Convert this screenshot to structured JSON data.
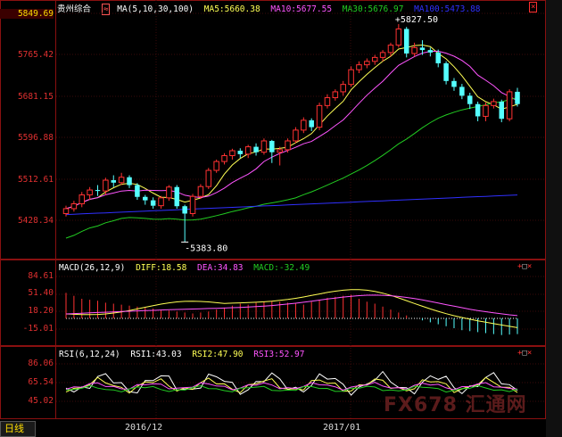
{
  "main": {
    "title": "贵州综合",
    "ma_label": "MA(5,10,30,100)",
    "ma5": "MA5:5660.38",
    "ma10": "MA10:5677.55",
    "ma30": "MA30:5676.97",
    "ma100": "MA100:5473.88",
    "y_labels": [
      "5849.69",
      "5765.42",
      "5681.15",
      "5596.88",
      "5512.61",
      "5428.34"
    ],
    "high_note": "5827.50",
    "low_note": "5383.80",
    "colors": {
      "up": "#ff3232",
      "down": "#55ffff",
      "ma5": "#ffff55",
      "ma10": "#ff55ff",
      "ma30": "#22cc22",
      "ma100": "#3030ff"
    }
  },
  "macd": {
    "label": "MACD(26,12,9)",
    "diff": "DIFF:18.58",
    "dea": "DEA:34.83",
    "macd": "MACD:-32.49",
    "y_labels": [
      "84.61",
      "51.40",
      "18.20",
      "-15.01"
    ]
  },
  "rsi": {
    "label": "RSI(6,12,24)",
    "rsi1": "RSI1:43.03",
    "rsi2": "RSI2:47.90",
    "rsi3": "RSI3:52.97",
    "y_labels": [
      "86.06",
      "65.54",
      "45.02"
    ]
  },
  "x_dates": [
    "2016/12",
    "2017/01"
  ],
  "period_button": "日线",
  "watermark": "FX678 汇通网",
  "candles": [
    [
      5442,
      5452,
      5436,
      5458
    ],
    [
      5452,
      5462,
      5446,
      5468
    ],
    [
      5462,
      5480,
      5455,
      5486
    ],
    [
      5480,
      5490,
      5470,
      5496
    ],
    [
      5490,
      5488,
      5478,
      5500
    ],
    [
      5488,
      5510,
      5480,
      5515
    ],
    [
      5510,
      5505,
      5496,
      5520
    ],
    [
      5505,
      5516,
      5500,
      5525
    ],
    [
      5516,
      5500,
      5494,
      5520
    ],
    [
      5500,
      5476,
      5470,
      5504
    ],
    [
      5476,
      5469,
      5460,
      5480
    ],
    [
      5469,
      5458,
      5452,
      5475
    ],
    [
      5458,
      5474,
      5452,
      5478
    ],
    [
      5474,
      5496,
      5468,
      5500
    ],
    [
      5496,
      5457,
      5452,
      5500
    ],
    [
      5457,
      5442,
      5384,
      5460
    ],
    [
      5442,
      5477,
      5436,
      5482
    ],
    [
      5477,
      5497,
      5472,
      5502
    ],
    [
      5497,
      5530,
      5492,
      5535
    ],
    [
      5530,
      5548,
      5525,
      5552
    ],
    [
      5548,
      5560,
      5542,
      5565
    ],
    [
      5560,
      5570,
      5552,
      5574
    ],
    [
      5570,
      5563,
      5555,
      5575
    ],
    [
      5563,
      5578,
      5555,
      5582
    ],
    [
      5578,
      5567,
      5560,
      5585
    ],
    [
      5567,
      5590,
      5562,
      5595
    ],
    [
      5590,
      5567,
      5545,
      5592
    ],
    [
      5567,
      5572,
      5540,
      5578
    ],
    [
      5572,
      5590,
      5566,
      5595
    ],
    [
      5590,
      5612,
      5585,
      5618
    ],
    [
      5612,
      5632,
      5606,
      5638
    ],
    [
      5632,
      5618,
      5610,
      5636
    ],
    [
      5618,
      5662,
      5612,
      5668
    ],
    [
      5662,
      5678,
      5656,
      5685
    ],
    [
      5678,
      5690,
      5672,
      5695
    ],
    [
      5690,
      5705,
      5682,
      5712
    ],
    [
      5705,
      5735,
      5700,
      5742
    ],
    [
      5735,
      5745,
      5728,
      5752
    ],
    [
      5745,
      5752,
      5738,
      5758
    ],
    [
      5752,
      5760,
      5745,
      5765
    ],
    [
      5760,
      5770,
      5752,
      5775
    ],
    [
      5770,
      5785,
      5762,
      5790
    ],
    [
      5785,
      5818,
      5780,
      5828
    ],
    [
      5818,
      5768,
      5760,
      5822
    ],
    [
      5768,
      5780,
      5762,
      5790
    ],
    [
      5780,
      5775,
      5765,
      5795
    ],
    [
      5775,
      5770,
      5762,
      5780
    ],
    [
      5770,
      5748,
      5740,
      5776
    ],
    [
      5748,
      5712,
      5705,
      5752
    ],
    [
      5712,
      5700,
      5692,
      5718
    ],
    [
      5700,
      5682,
      5675,
      5706
    ],
    [
      5682,
      5665,
      5655,
      5688
    ],
    [
      5665,
      5640,
      5630,
      5670
    ],
    [
      5640,
      5662,
      5630,
      5668
    ],
    [
      5662,
      5670,
      5656,
      5676
    ],
    [
      5670,
      5635,
      5628,
      5674
    ],
    [
      5635,
      5690,
      5630,
      5695
    ],
    [
      5690,
      5665,
      5660,
      5698
    ]
  ],
  "macd_bars": [
    52,
    46,
    40,
    38,
    36,
    32,
    30,
    28,
    26,
    24,
    22,
    20,
    18,
    16,
    14,
    12,
    10,
    12,
    14,
    18,
    22,
    26,
    30,
    28,
    32,
    34,
    36,
    34,
    32,
    30,
    28,
    34,
    38,
    42,
    44,
    46,
    48,
    40,
    34,
    30,
    24,
    18,
    12,
    6,
    0,
    -4,
    -8,
    -12,
    -16,
    -20,
    -24,
    -26,
    -28,
    -30,
    -32,
    -34,
    -33,
    -32
  ]
}
